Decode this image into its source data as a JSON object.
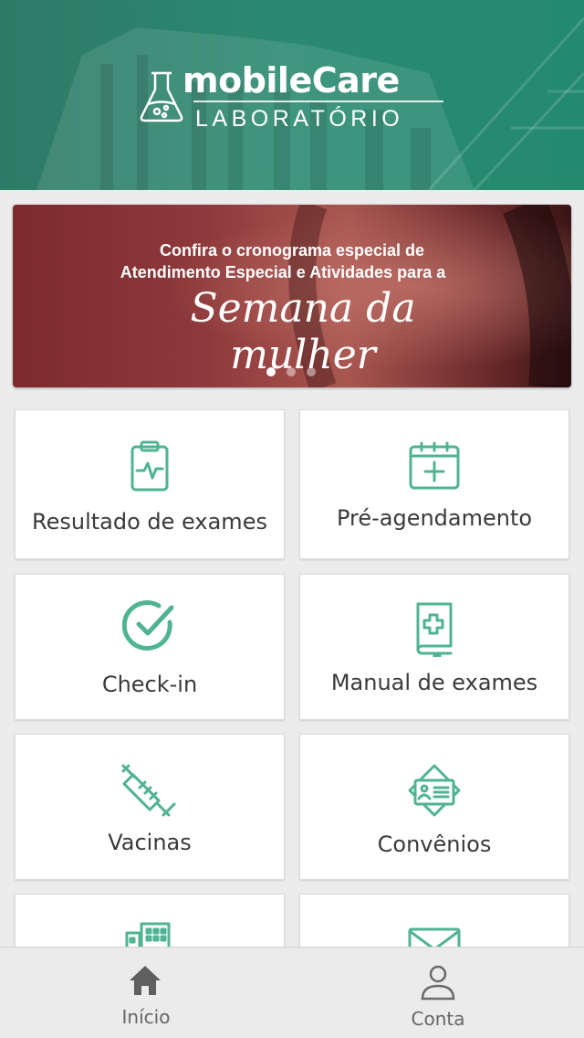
{
  "header": {
    "brand": "mobileCare",
    "subtitle": "LABORATÓRIO"
  },
  "banner": {
    "line1": "Confira o cronograma especial de",
    "line2": "Atendimento Especial e Atividades para a",
    "script": "Semana da mulher",
    "slides": 3,
    "active_slide": 1
  },
  "tiles": [
    {
      "label": "Resultado de exames",
      "icon": "clipboard-pulse-icon"
    },
    {
      "label": "Pré-agendamento",
      "icon": "calendar-plus-icon"
    },
    {
      "label": "Check-in",
      "icon": "check-circle-icon"
    },
    {
      "label": "Manual de exames",
      "icon": "medical-book-icon"
    },
    {
      "label": "Vacinas",
      "icon": "syringe-icon"
    },
    {
      "label": "Convênios",
      "icon": "id-card-icon"
    },
    {
      "label": "",
      "icon": "building-icon"
    },
    {
      "label": "",
      "icon": "envelope-icon"
    }
  ],
  "bottom_nav": {
    "home_label": "Início",
    "account_label": "Conta"
  },
  "colors": {
    "accent": "#4fb394",
    "header": "#2a8a70",
    "banner": "#8e3a3c"
  }
}
